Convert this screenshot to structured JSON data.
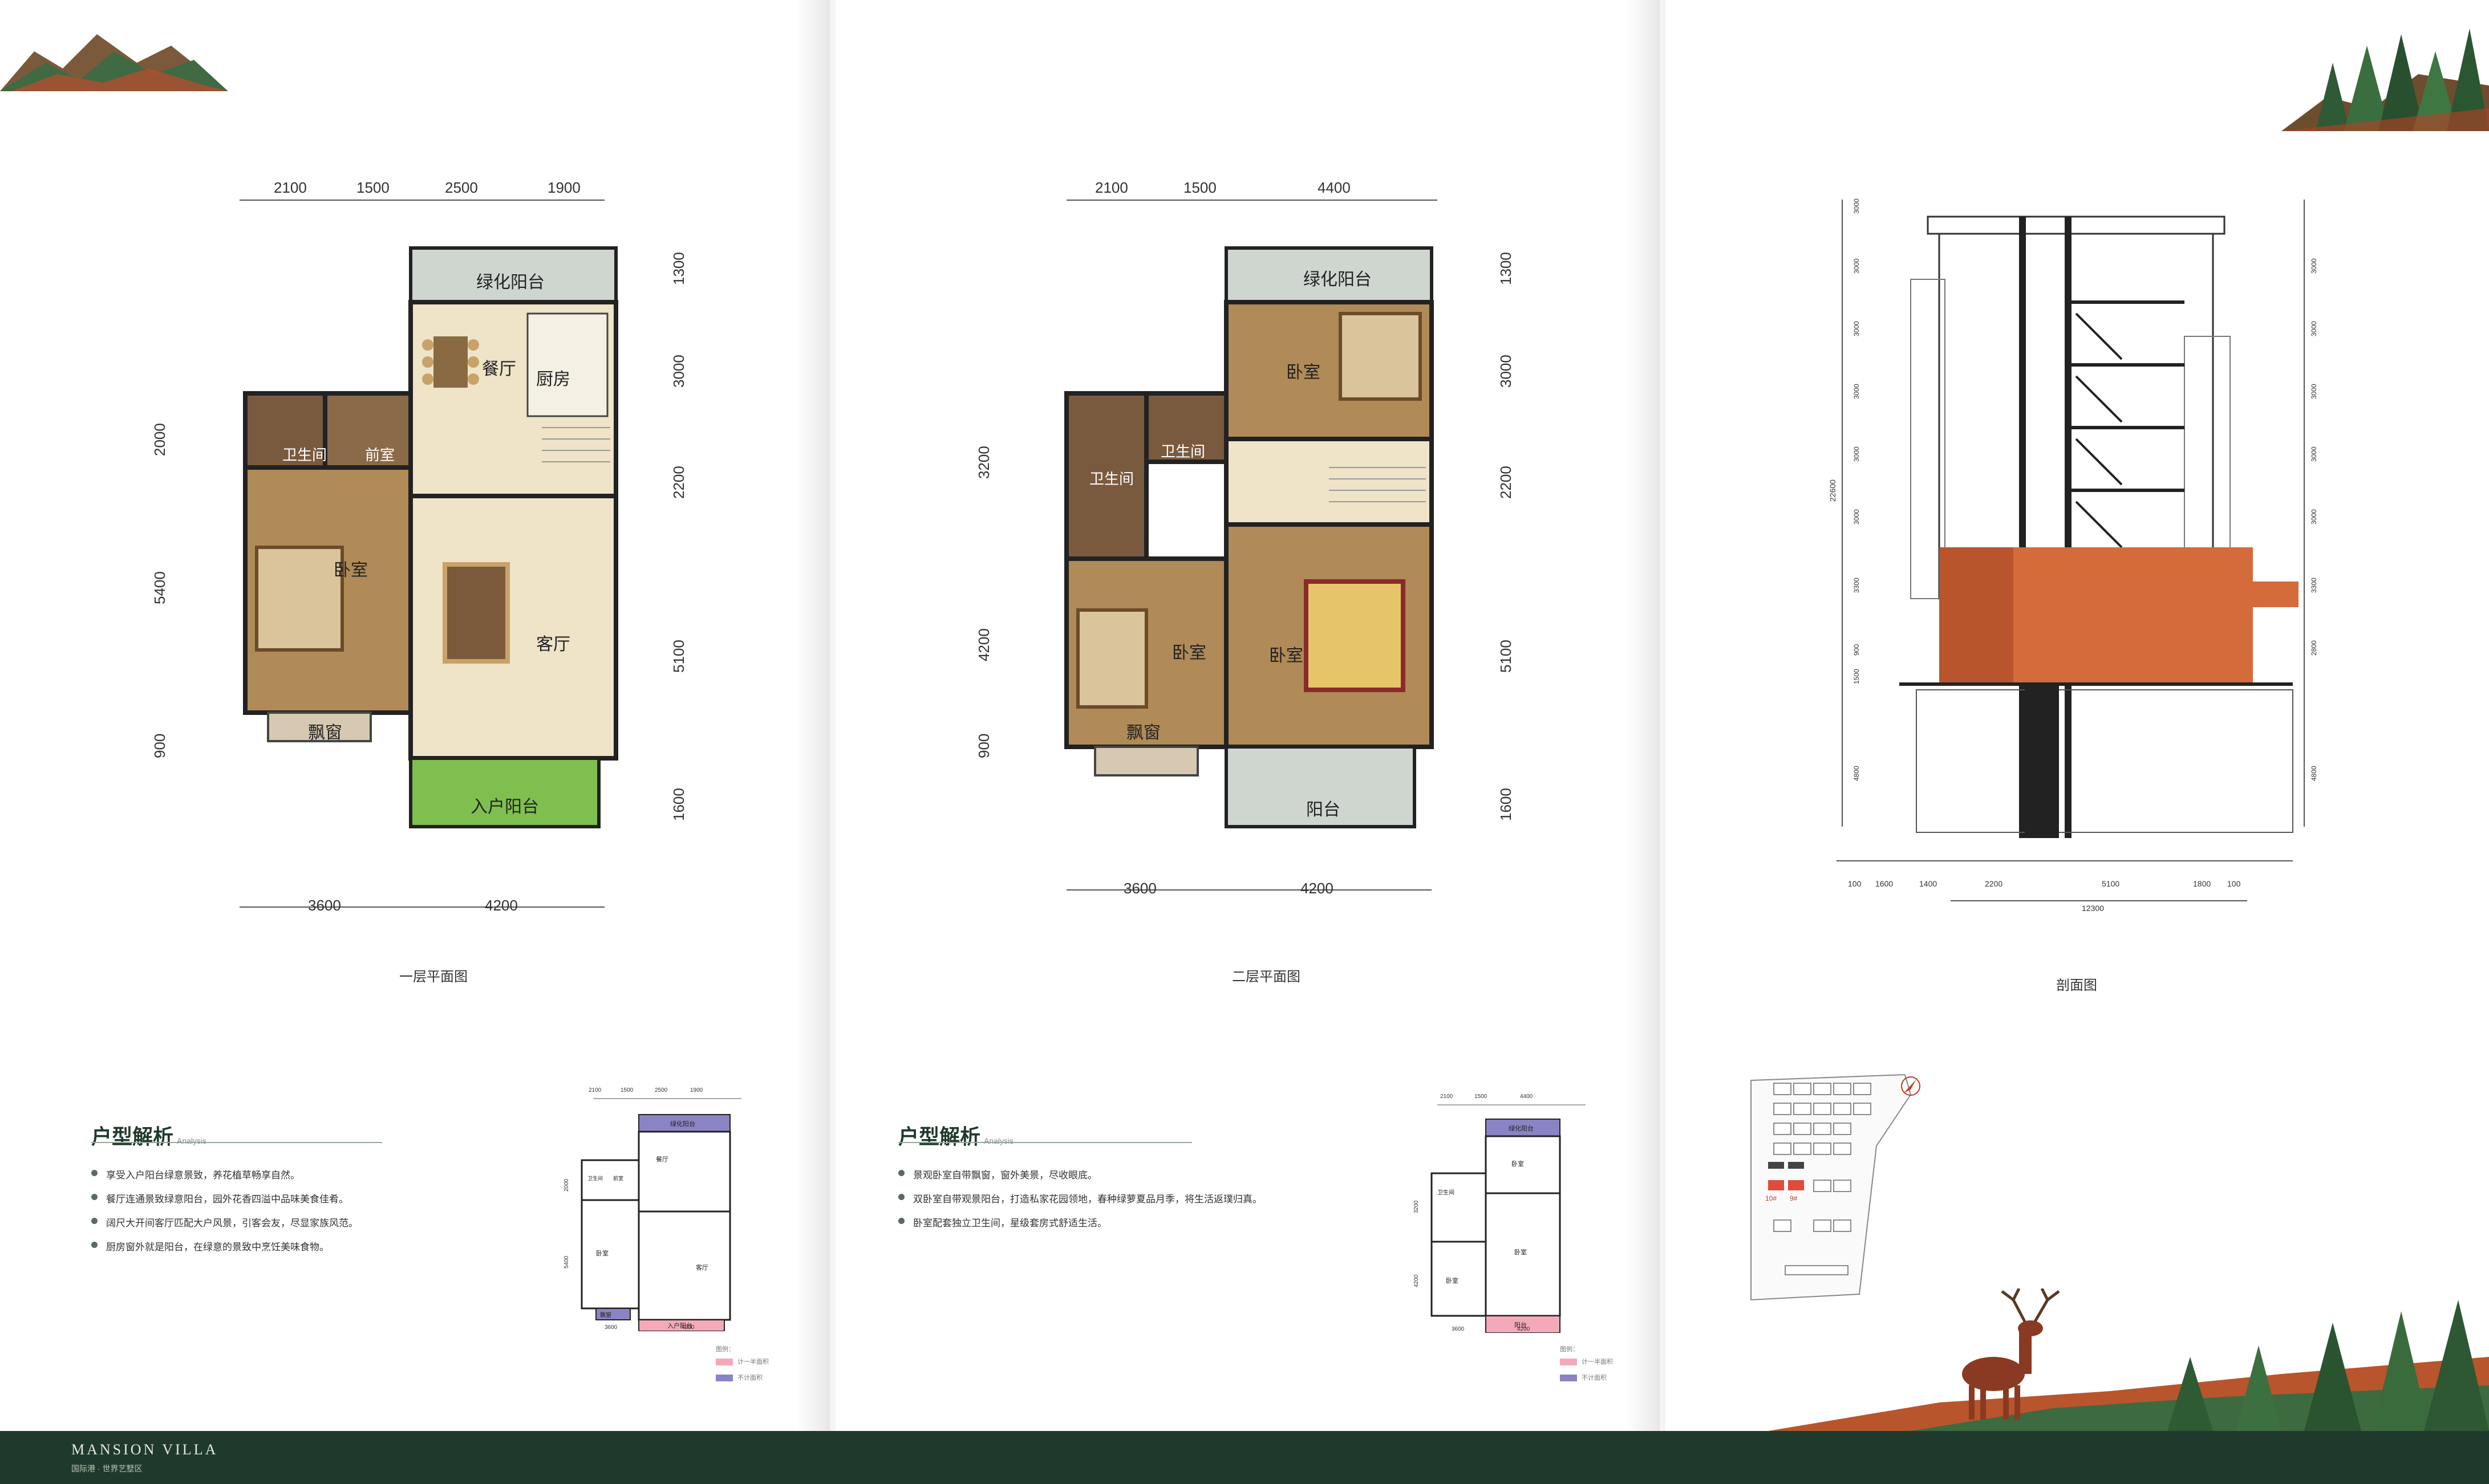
{
  "brand": {
    "name": "MANSION VILLA",
    "sub": "国际港 · 世界艺墅区"
  },
  "floor1": {
    "caption": "一层平面图",
    "dims_top": [
      "2100",
      "1500",
      "2500",
      "1900"
    ],
    "dims_bottom": [
      "3600",
      "4200"
    ],
    "dims_left": [
      "2000",
      "5400",
      "900"
    ],
    "dims_right": [
      "1300",
      "3000",
      "2200",
      "5100",
      "1600"
    ],
    "rooms": {
      "green_balcony": "绿化阳台",
      "dining": "餐厅",
      "kitchen": "厨房",
      "bath": "卫生间",
      "foyer": "前室",
      "bedroom": "卧室",
      "living": "客厅",
      "bay": "飘窗",
      "entry_balcony": "入户阳台"
    }
  },
  "floor2": {
    "caption": "二层平面图",
    "dims_top": [
      "2100",
      "1500",
      "4400"
    ],
    "dims_bottom": [
      "3600",
      "4200"
    ],
    "dims_left": [
      "3200",
      "4200",
      "900"
    ],
    "dims_right": [
      "1300",
      "3000",
      "2200",
      "5100",
      "1600"
    ],
    "rooms": {
      "green_balcony": "绿化阳台",
      "bedroom_a": "卧室",
      "bath_a": "卫生间",
      "bath_b": "卫生间",
      "bedroom_b": "卧室",
      "bedroom_c": "卧室",
      "bay": "飘窗",
      "balcony": "阳台"
    }
  },
  "section": {
    "caption": "剖面图",
    "dims_bottom": [
      "100",
      "1600",
      "1400",
      "2200",
      "5100",
      "1800",
      "100"
    ],
    "total": "12300",
    "left_total": "22600",
    "left_dims": [
      "3000",
      "3000",
      "3000",
      "3000",
      "3000",
      "3000",
      "3300",
      "900",
      "1500",
      "4800"
    ],
    "right_dims": [
      "3000",
      "3000",
      "3000",
      "3000",
      "3000",
      "3300",
      "2800",
      "4800"
    ]
  },
  "analysis1": {
    "title": "户型解析",
    "title_en": "Analysis",
    "bullets": [
      "享受入户阳台绿意景致，养花植草畅享自然。",
      "餐厅连通景致绿意阳台，园外花香四溢中品味美食佳肴。",
      "阔尺大开间客厅匹配大户风景，引客会友，尽显家族风范。",
      "厨房窗外就是阳台，在绿意的景致中烹饪美味食物。"
    ]
  },
  "analysis2": {
    "title": "户型解析",
    "title_en": "Analysis",
    "bullets": [
      "景观卧室自带飘窗，窗外美景，尽收眼底。",
      "双卧室自带观景阳台，打造私家花园领地，春种绿萝夏品月季，将生活返璞归真。",
      "卧室配套独立卫生间，星级套房式舒适生活。"
    ]
  },
  "mini1": {
    "dims_top": [
      "2100",
      "1500",
      "2500",
      "1900"
    ],
    "dims_bottom": [
      "3600",
      "4200"
    ],
    "dims_left": [
      "2000",
      "5400"
    ],
    "rooms": {
      "green_balcony": "绿化阳台",
      "dining": "餐厅",
      "bath": "卫生间",
      "foyer": "前室",
      "bedroom": "卧室",
      "living": "客厅",
      "bay": "飘窗",
      "entry_balcony": "入户阳台"
    },
    "legend": {
      "title": "图例：",
      "pink": "计一半面积",
      "purple": "不计面积"
    }
  },
  "mini2": {
    "dims_top": [
      "2100",
      "1500",
      "4400"
    ],
    "dims_bottom": [
      "3600",
      "4200"
    ],
    "dims_left": [
      "3200",
      "4200"
    ],
    "rooms": {
      "green_balcony": "绿化阳台",
      "bath": "卫生间",
      "bedroom_a": "卧室",
      "bedroom_b": "卧室",
      "bedroom_c": "卧室",
      "balcony": "阳台"
    },
    "legend": {
      "title": "图例：",
      "pink": "计一半面积",
      "purple": "不计面积"
    }
  },
  "siteplan": {
    "marker_a": "10#",
    "marker_b": "9#"
  },
  "colors": {
    "floor_wood": "#b08a57",
    "tile": "#efe3c8",
    "wall": "#2a2a2a",
    "section_highlight": "#d56a3a",
    "footer": "#1f3a2c",
    "grass": "#7fbf4f",
    "pink": "#f3a9b8",
    "purple": "#8a84c4"
  },
  "icons": [
    "mountain-deco",
    "forest-deco",
    "deer-deco",
    "north-arrow-icon"
  ]
}
